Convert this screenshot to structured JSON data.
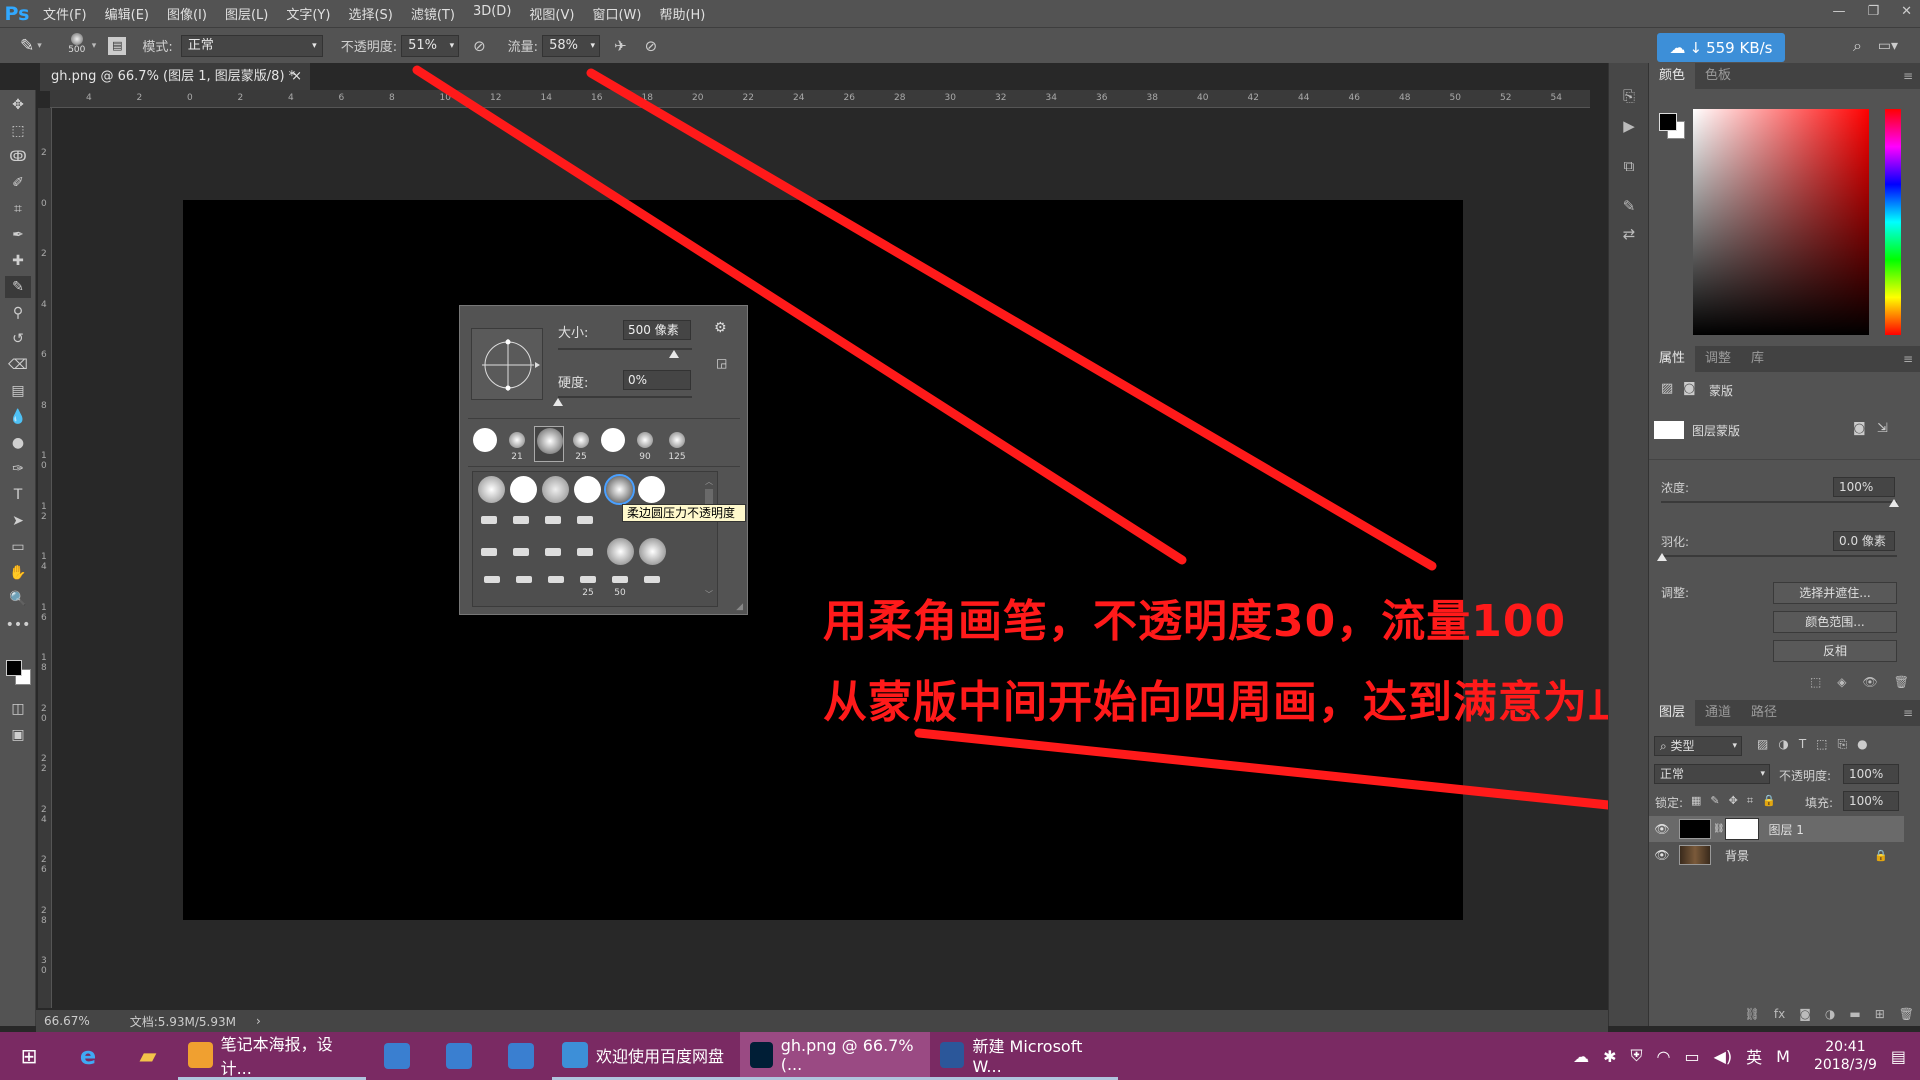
{
  "app": {
    "logo": "Ps",
    "menus": [
      "文件(F)",
      "编辑(E)",
      "图像(I)",
      "图层(L)",
      "文字(Y)",
      "选择(S)",
      "滤镜(T)",
      "3D(D)",
      "视图(V)",
      "窗口(W)",
      "帮助(H)"
    ]
  },
  "options_bar": {
    "brush_size": "500",
    "mode_label": "模式:",
    "mode_value": "正常",
    "opacity_label": "不透明度:",
    "opacity_value": "51%",
    "flow_label": "流量:",
    "flow_value": "58%",
    "net_speed": "559 KB/s"
  },
  "document": {
    "tab_title": "gh.png @ 66.7% (图层 1, 图层蒙版/8) *",
    "zoom": "66.67%",
    "doc_size": "文档:5.93M/5.93M"
  },
  "ruler": {
    "h_ticks": [
      "4",
      "2",
      "0",
      "2",
      "4",
      "6",
      "8",
      "10",
      "12",
      "14",
      "16",
      "18",
      "20",
      "22",
      "24",
      "26",
      "28",
      "30",
      "32",
      "34",
      "36",
      "38",
      "40",
      "42",
      "44",
      "46",
      "48",
      "50",
      "52",
      "54"
    ],
    "v_ticks": [
      "2",
      "0",
      "2",
      "4",
      "6",
      "8",
      "1\n0",
      "1\n2",
      "1\n4",
      "1\n6",
      "1\n8",
      "2\n0",
      "2\n2",
      "2\n4",
      "2\n6",
      "2\n8",
      "3\n0"
    ]
  },
  "brush_popup": {
    "size_label": "大小:",
    "size_value": "500 像素",
    "hardness_label": "硬度:",
    "hardness_value": "0%",
    "recent_sizes": [
      "",
      "21",
      "",
      "25",
      "",
      "90",
      "125"
    ],
    "row4_labels": [
      "",
      "",
      "",
      "25",
      "50",
      ""
    ],
    "tooltip": "柔边圆压力不透明度"
  },
  "annotation": {
    "line1": "用柔角画笔，不透明度30，流量100",
    "line2": "从蒙版中间开始向四周画，达到满意为止",
    "color": "#ff1a1a"
  },
  "color_panel": {
    "tabs": [
      "颜色",
      "色板"
    ]
  },
  "properties_panel": {
    "tabs": [
      "属性",
      "调整",
      "库"
    ],
    "mask_title": "蒙版",
    "layer_mask_label": "图层蒙版",
    "density_label": "浓度:",
    "density_value": "100%",
    "feather_label": "羽化:",
    "feather_value": "0.0 像素",
    "adjust_label": "调整:",
    "select_mask_btn": "选择并遮住...",
    "color_range_btn": "颜色范围...",
    "invert_btn": "反相"
  },
  "layers_panel": {
    "tabs": [
      "图层",
      "通道",
      "路径"
    ],
    "filter_kind": "类型",
    "blend_mode": "正常",
    "opacity_label": "不透明度:",
    "opacity_value": "100%",
    "lock_label": "锁定:",
    "fill_label": "填充:",
    "fill_value": "100%",
    "layers": [
      {
        "name": "图层 1"
      },
      {
        "name": "背景"
      }
    ]
  },
  "taskbar": {
    "apps": [
      {
        "label": "笔记本海报，设计...",
        "icon_color": "#f0a030"
      },
      {
        "label": "欢迎使用百度网盘",
        "icon_color": "#3d8fd8"
      },
      {
        "label": "gh.png @ 66.7% (...",
        "icon_color": "#001e36"
      },
      {
        "label": "新建 Microsoft W...",
        "icon_color": "#2b579a"
      }
    ],
    "ime": "英",
    "ime2": "M",
    "time": "20:41",
    "date": "2018/3/9"
  }
}
